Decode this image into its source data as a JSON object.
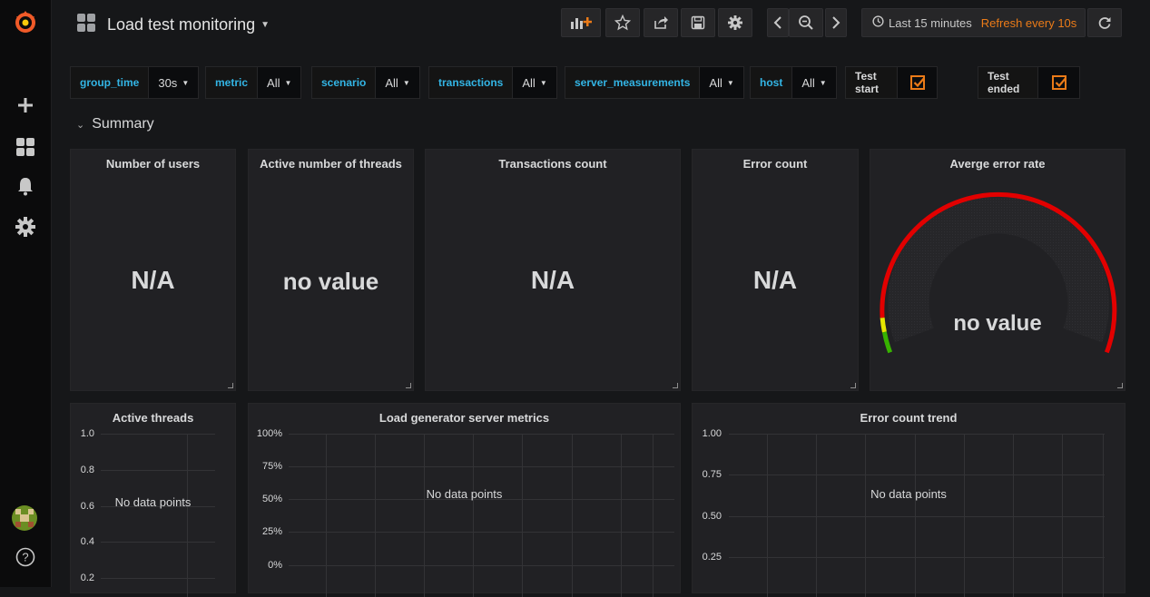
{
  "header": {
    "title": "Load test monitoring",
    "time_range": "Last 15 minutes",
    "refresh": "Refresh every 10s"
  },
  "icons": {
    "logo": "grafana-logo-icon",
    "create": "plus-icon",
    "dashboards": "grid-icon",
    "alerting": "bell-icon",
    "configuration": "gear-icon",
    "help": "question-icon",
    "add_panel": "add-panel-icon",
    "star": "star-icon",
    "share": "share-icon",
    "save": "save-icon",
    "settings": "gear-icon",
    "back": "chevron-left-icon",
    "zoom_out": "zoom-out-icon",
    "forward": "chevron-right-icon",
    "clock": "clock-icon",
    "refresh": "refresh-icon"
  },
  "colors": {
    "accent": "#eb7b18",
    "variable_label": "#33b5e5",
    "gauge_red": "#e20000",
    "gauge_yellow": "#e5e500",
    "gauge_green": "#37b300"
  },
  "variables": [
    {
      "label": "group_time",
      "value": "30s"
    },
    {
      "label": "metric",
      "value": "All"
    },
    {
      "label": "scenario",
      "value": "All"
    },
    {
      "label": "transactions",
      "value": "All"
    },
    {
      "label": "server_measurements",
      "value": "All"
    },
    {
      "label": "host",
      "value": "All"
    }
  ],
  "checkboxes": [
    {
      "label": "Test start",
      "checked": true
    },
    {
      "label": "Test ended",
      "checked": true
    }
  ],
  "row": {
    "title": "Summary"
  },
  "stats": [
    {
      "title": "Number of users",
      "value": "N/A"
    },
    {
      "title": "Active number of threads",
      "value": "no value"
    },
    {
      "title": "Transactions count",
      "value": "N/A"
    },
    {
      "title": "Error count",
      "value": "N/A"
    },
    {
      "title": "Averge error rate",
      "value": "no value"
    }
  ],
  "graphs": [
    {
      "title": "Active threads",
      "no_data": "No data points",
      "y_ticks": [
        "1.0",
        "0.8",
        "0.6",
        "0.4",
        "0.2"
      ]
    },
    {
      "title": "Load generator server metrics",
      "no_data": "No data points",
      "y_ticks": [
        "100%",
        "75%",
        "50%",
        "25%",
        "0%"
      ]
    },
    {
      "title": "Error count trend",
      "no_data": "No data points",
      "y_ticks": [
        "1.00",
        "0.75",
        "0.50",
        "0.25"
      ]
    }
  ]
}
